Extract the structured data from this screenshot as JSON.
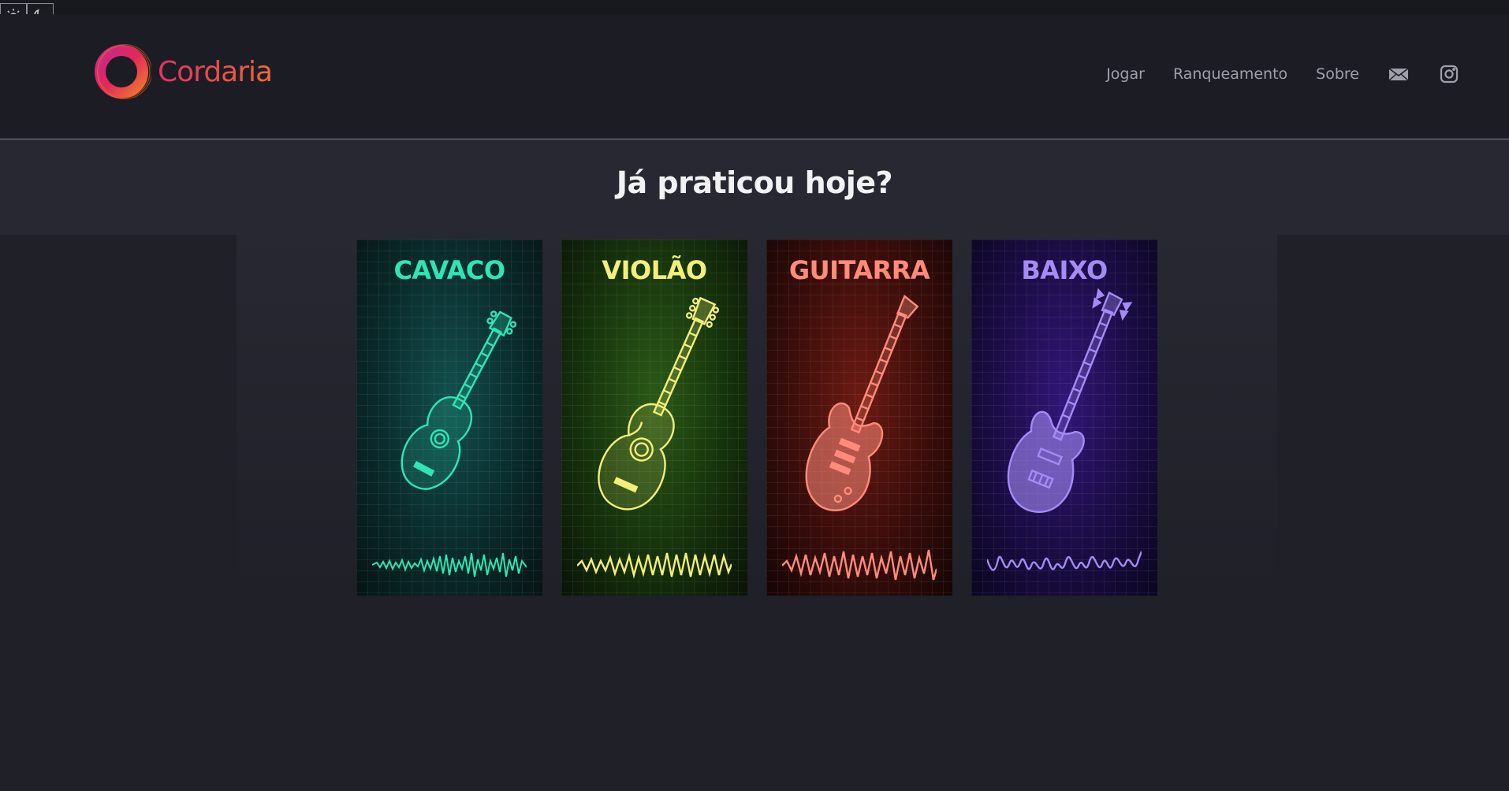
{
  "theme": {
    "light_icon": "sun-icon",
    "dark_icon": "moon-icon"
  },
  "brand": {
    "name": "Cordaria"
  },
  "nav": {
    "items": [
      {
        "label": "Jogar"
      },
      {
        "label": "Ranqueamento"
      },
      {
        "label": "Sobre"
      }
    ],
    "email_icon": "mail-icon",
    "instagram_icon": "instagram-icon"
  },
  "hero": {
    "title": "Já praticou hoje?"
  },
  "instruments": [
    {
      "title": "CAVACO",
      "color": "#2ee6b3"
    },
    {
      "title": "VIOLÃO",
      "color": "#f4ef78"
    },
    {
      "title": "GUITARRA",
      "color": "#ff8b7a"
    },
    {
      "title": "BAIXO",
      "color": "#a48bf5"
    }
  ]
}
